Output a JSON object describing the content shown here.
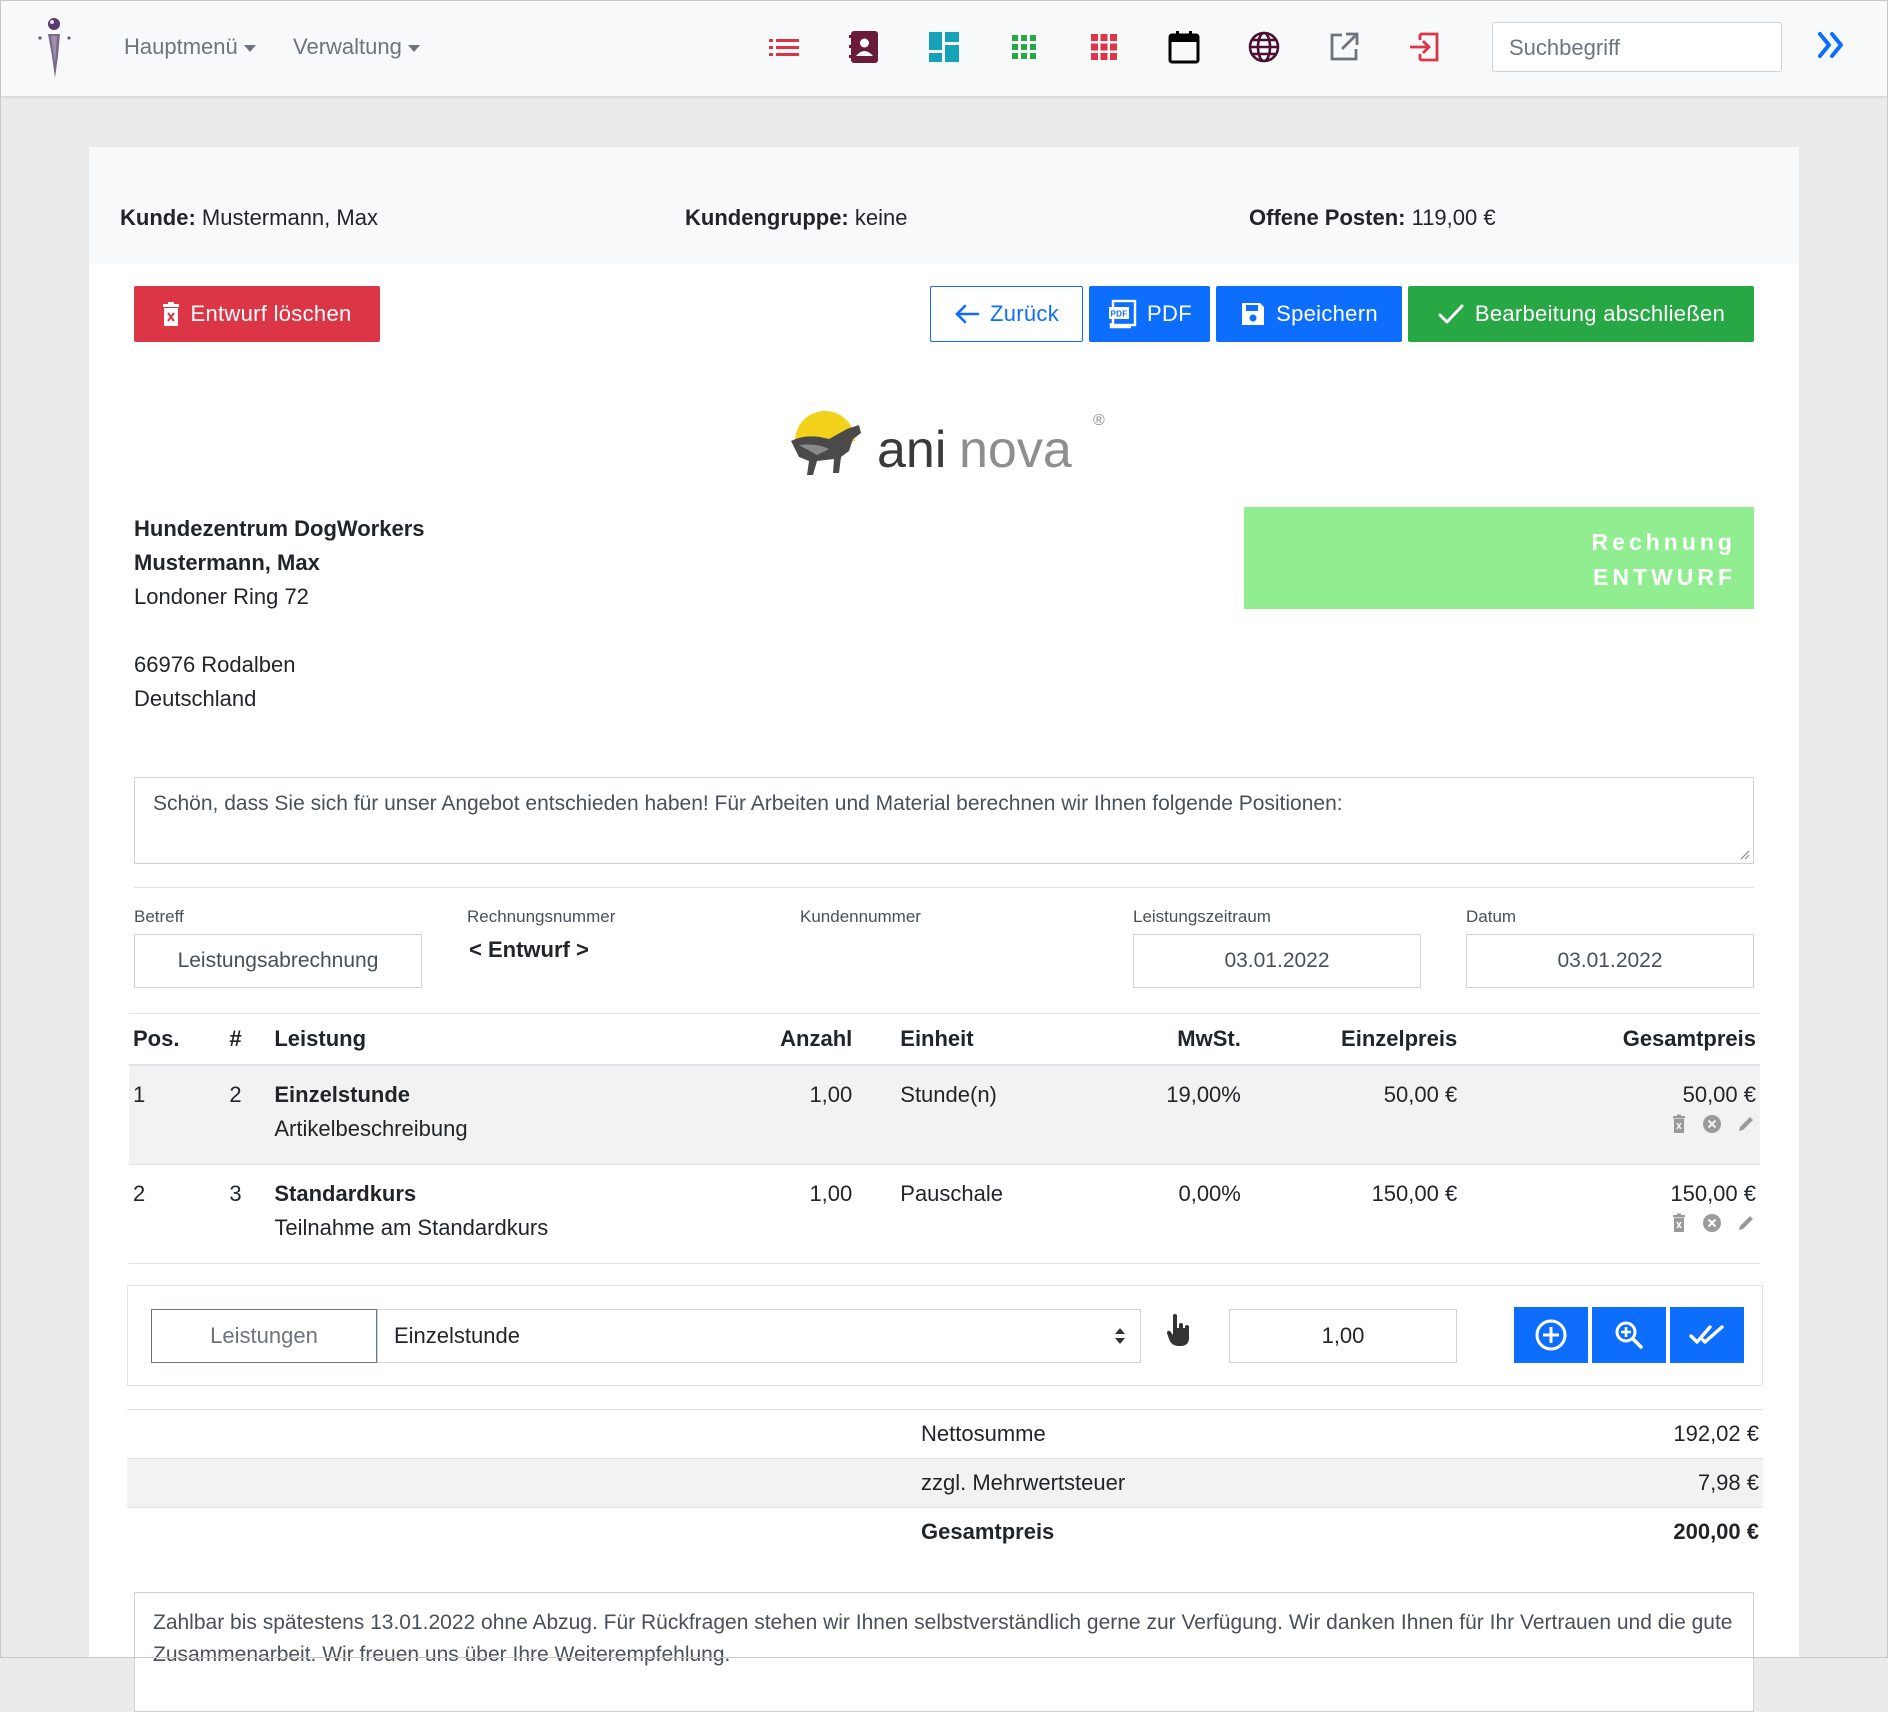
{
  "nav": {
    "menu_main": "Hauptmenü",
    "menu_admin": "Verwaltung",
    "search_placeholder": "Suchbegriff",
    "icons": [
      "list-icon",
      "contact-book-icon",
      "dashboard-icon",
      "grid-icon",
      "grid-red-icon",
      "calendar-icon",
      "globe-icon",
      "external-link-icon",
      "logout-icon"
    ]
  },
  "header": {
    "customer_label": "Kunde:",
    "customer_value": "Mustermann, Max",
    "group_label": "Kundengruppe:",
    "group_value": "keine",
    "open_label": "Offene Posten:",
    "open_value": "119,00 €"
  },
  "actions": {
    "delete": "Entwurf löschen",
    "back": "Zurück",
    "pdf": "PDF",
    "save": "Speichern",
    "finish": "Bearbeitung abschließen"
  },
  "brand": {
    "name_dark": "ani",
    "name_light": "nova",
    "registered": "®"
  },
  "address": {
    "company": "Hundezentrum DogWorkers",
    "name": "Mustermann, Max",
    "street": "Londoner Ring 72",
    "city": "66976 Rodalben",
    "country": "Deutschland"
  },
  "status": {
    "line1": "Rechnung",
    "line2": "ENTWURF"
  },
  "intro_text": "Schön, dass Sie sich für unser Angebot entschieden haben! Für Arbeiten und Material berechnen wir Ihnen folgende Positionen:",
  "fields": {
    "subject_label": "Betreff",
    "subject_value": "Leistungsabrechnung",
    "invoice_no_label": "Rechnungsnummer",
    "invoice_no_value": "< Entwurf >",
    "customer_no_label": "Kundennummer",
    "period_label": "Leistungszeitraum",
    "period_value": "03.01.2022",
    "date_label": "Datum",
    "date_value": "03.01.2022"
  },
  "table": {
    "headers": {
      "pos": "Pos.",
      "num": "#",
      "service": "Leistung",
      "qty": "Anzahl",
      "unit": "Einheit",
      "vat": "MwSt.",
      "unit_price": "Einzelpreis",
      "total": "Gesamtpreis"
    },
    "rows": [
      {
        "pos": "1",
        "num": "2",
        "title": "Einzelstunde",
        "desc": "Artikelbeschreibung",
        "qty": "1,00",
        "unit": "Stunde(n)",
        "vat": "19,00%",
        "unit_price": "50,00 €",
        "total": "50,00 €"
      },
      {
        "pos": "2",
        "num": "3",
        "title": "Standardkurs",
        "desc": "Teilnahme am Standardkurs",
        "qty": "1,00",
        "unit": "Pauschale",
        "vat": "0,00%",
        "unit_price": "150,00 €",
        "total": "150,00 €"
      }
    ]
  },
  "adder": {
    "label": "Leistungen",
    "selected": "Einzelstunde",
    "qty": "1,00"
  },
  "sums": {
    "net_label": "Nettosumme",
    "net_value": "192,02 €",
    "vat_label": "zzgl. Mehrwertsteuer",
    "vat_value": "7,98 €",
    "total_label": "Gesamtpreis",
    "total_value": "200,00 €"
  },
  "footer_text": "Zahlbar bis spätestens 13.01.2022 ohne Abzug. Für Rückfragen stehen wir Ihnen selbstverständlich gerne zur Verfügung. Wir danken Ihnen für Ihr Vertrauen und die gute Zusammenarbeit. Wir freuen uns über Ihre Weiterempfehlung.",
  "colors": {
    "primary": "#0d6efd",
    "danger": "#dc3545",
    "success": "#28a745",
    "draft": "#90ee90"
  }
}
